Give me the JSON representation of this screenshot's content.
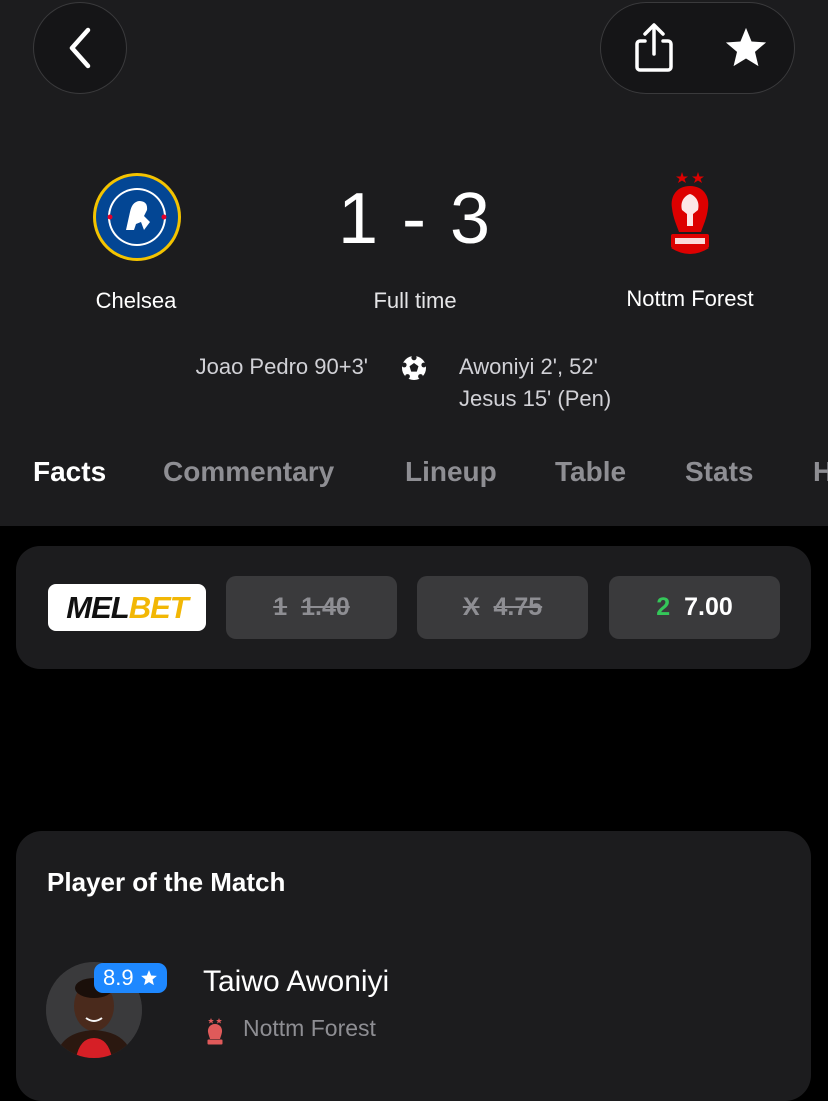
{
  "match": {
    "home_team": "Chelsea",
    "away_team": "Nottm Forest",
    "score": "1 - 3",
    "status": "Full time",
    "home_scorers": [
      "Joao Pedro 90+3'"
    ],
    "away_scorers": [
      "Awoniyi 2', 52'",
      "Jesus 15' (Pen)"
    ]
  },
  "tabs": [
    {
      "label": "Facts",
      "active": true
    },
    {
      "label": "Commentary"
    },
    {
      "label": "Lineup"
    },
    {
      "label": "Table"
    },
    {
      "label": "Stats"
    },
    {
      "label": "H"
    }
  ],
  "odds": {
    "brand": {
      "part1": "MEL",
      "part2": "BET"
    },
    "options": [
      {
        "sel": "1",
        "value": "1.40",
        "struck": true
      },
      {
        "sel": "X",
        "value": "4.75",
        "struck": true
      },
      {
        "sel": "2",
        "value": "7.00",
        "struck": false
      }
    ]
  },
  "potm": {
    "title": "Player of the Match",
    "rating": "8.9",
    "player_name": "Taiwo Awoniyi",
    "team": "Nottm Forest"
  },
  "icons": {
    "back": "chevron-left-icon",
    "share": "share-icon",
    "favorite": "star-icon",
    "goal": "soccer-ball-icon"
  },
  "colors": {
    "accent_green": "#34c759",
    "rating_blue": "#1e88ff",
    "chelsea_blue": "#034694",
    "forest_red": "#dd0000"
  }
}
